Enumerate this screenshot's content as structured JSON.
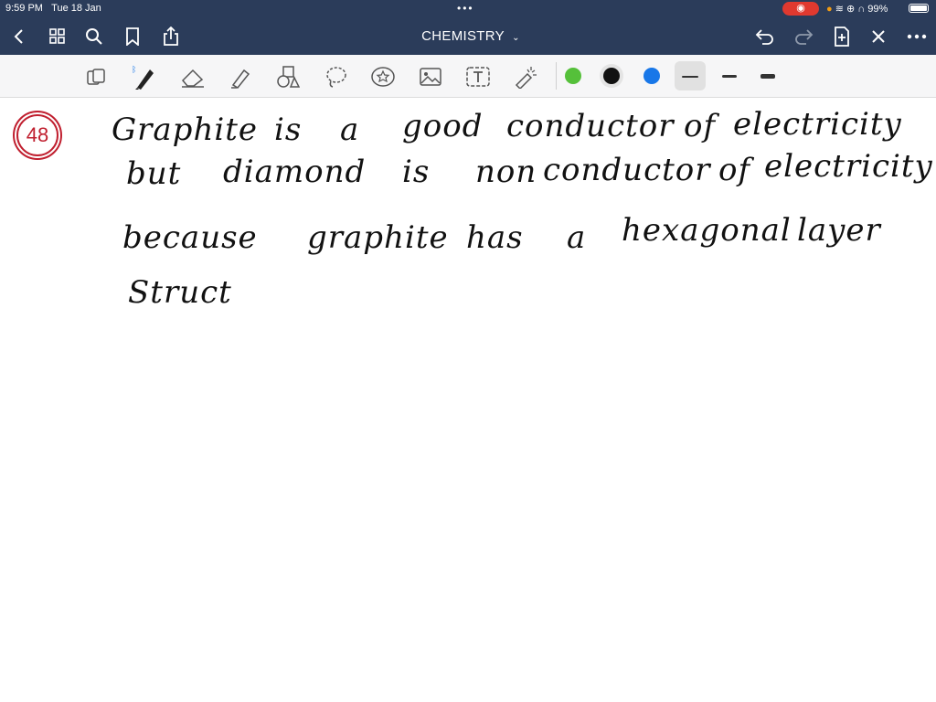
{
  "status": {
    "time": "9:59 PM",
    "date": "Tue 18 Jan",
    "battery": "99%"
  },
  "nav": {
    "title": "CHEMISTRY"
  },
  "toolbar": {
    "colors": [
      "#55c03a",
      "#111111",
      "#1877e8"
    ],
    "selected_color": "#111111"
  },
  "note": {
    "question_number": "48",
    "lines": [
      [
        "Graphite",
        "is",
        "a",
        "good",
        "conductor",
        "of",
        "electricity"
      ],
      [
        "but",
        "diamond",
        "is",
        "non",
        "conductor",
        "of",
        "electricity"
      ],
      [
        "because",
        "graphite",
        "has",
        "a",
        "hexagonal",
        "layer"
      ],
      [
        "Struct"
      ]
    ]
  }
}
